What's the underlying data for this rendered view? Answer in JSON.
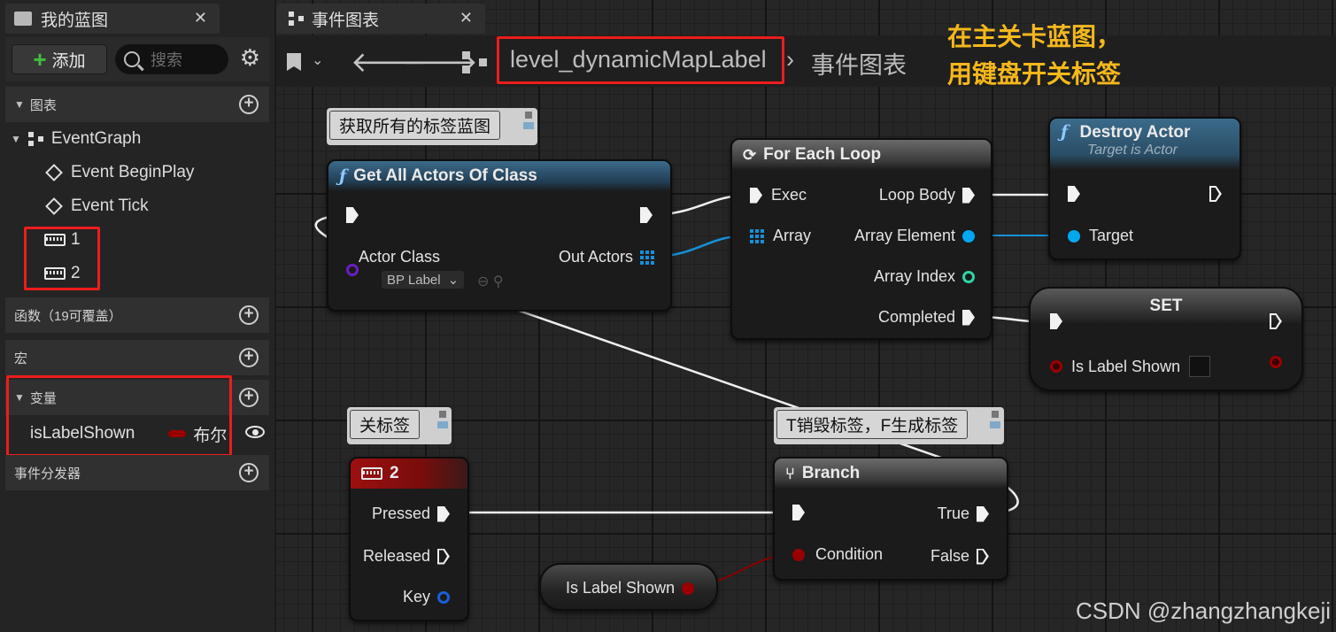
{
  "left_panel": {
    "tab_title": "我的蓝图",
    "tab_close": "✕",
    "add_label": "添加",
    "search_placeholder": "搜索",
    "graphs_section": "图表",
    "event_graph": "EventGraph",
    "events": [
      "Event BeginPlay",
      "Event Tick"
    ],
    "key_events": [
      "1",
      "2"
    ],
    "functions_section": "函数（19可覆盖）",
    "macros_section": "宏",
    "variables_section": "变量",
    "variable": {
      "name": "isLabelShown",
      "type": "布尔",
      "type_color": "#9a0000"
    },
    "dispatchers_section": "事件分发器"
  },
  "graph_tab": {
    "title": "事件图表",
    "close": "✕"
  },
  "breadcrumb": {
    "blueprint": "level_dynamicMapLabel",
    "graph": "事件图表"
  },
  "annotation": {
    "line1": "在主关卡蓝图，",
    "line2": "用键盘开关标签"
  },
  "watermark": "CSDN @zhangzhangkeji",
  "comments": {
    "get_actors": "获取所有的标签蓝图",
    "close_label": "关标签",
    "branch_note": "T销毁标签，F生成标签"
  },
  "nodes": {
    "get_all_actors": {
      "title": "Get All Actors Of Class",
      "actor_class": "Actor Class",
      "class_value": "BP Label",
      "out_actors": "Out Actors"
    },
    "for_each": {
      "title": "For Each Loop",
      "exec": "Exec",
      "array": "Array",
      "loop_body": "Loop Body",
      "array_element": "Array Element",
      "array_index": "Array Index",
      "completed": "Completed"
    },
    "destroy_actor": {
      "title": "Destroy Actor",
      "subtitle": "Target is Actor",
      "target": "Target"
    },
    "set": {
      "title": "SET",
      "var": "Is Label Shown"
    },
    "key2": {
      "title": "2",
      "pressed": "Pressed",
      "released": "Released",
      "key": "Key"
    },
    "branch": {
      "title": "Branch",
      "condition": "Condition",
      "true_pin": "True",
      "false_pin": "False"
    },
    "get_var": {
      "label": "Is Label Shown"
    }
  },
  "colors": {
    "highlight_box": "#ee1c1c",
    "annotation": "#f5b81b",
    "object_pin": "#00a8f0",
    "bool_pin": "#9a0000",
    "int_pin": "#2fd3a6",
    "class_pin": "#6a1fbf"
  }
}
